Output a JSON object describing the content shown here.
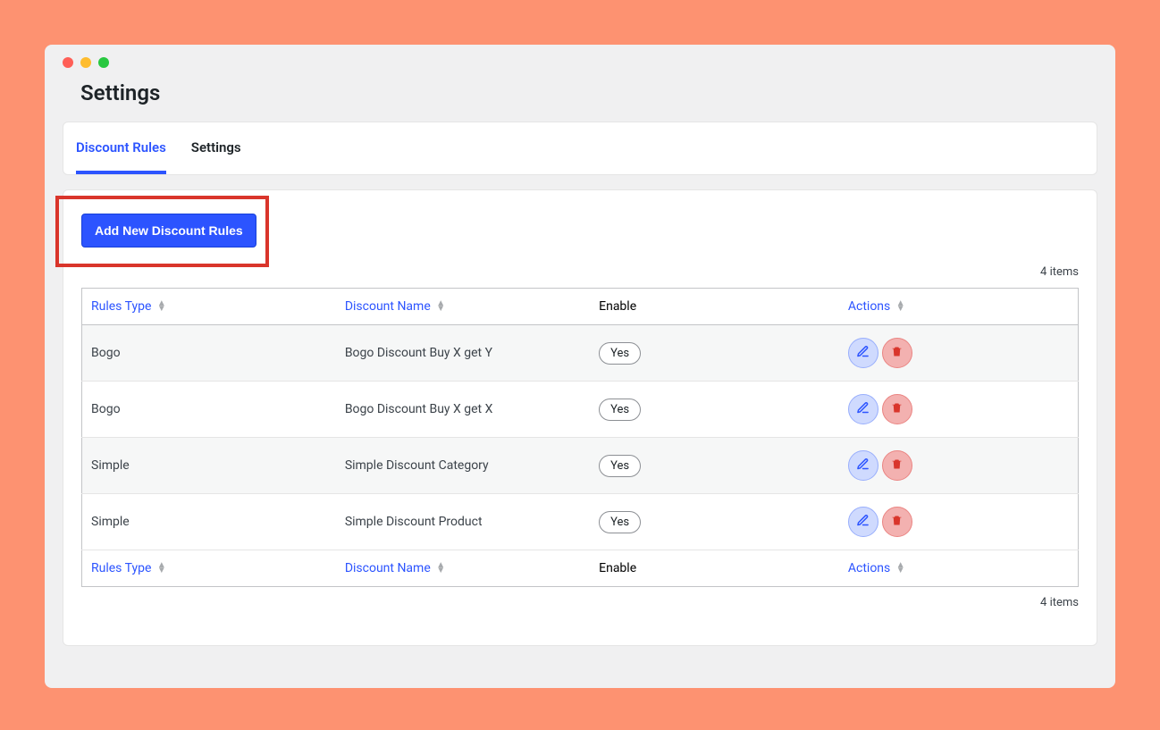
{
  "page_title": "Settings",
  "tabs": [
    {
      "label": "Discount Rules",
      "active": true
    },
    {
      "label": "Settings",
      "active": false
    }
  ],
  "buttons": {
    "add_new": "Add New Discount Rules"
  },
  "items_count_label": "4 items",
  "columns": {
    "rules_type": "Rules Type",
    "discount_name": "Discount Name",
    "enable": "Enable",
    "actions": "Actions"
  },
  "icons": {
    "edit": "pencil-icon",
    "delete": "trash-icon"
  },
  "rows": [
    {
      "type": "Bogo",
      "name": "Bogo Discount Buy X get Y",
      "enable": "Yes"
    },
    {
      "type": "Bogo",
      "name": "Bogo Discount Buy X get X",
      "enable": "Yes"
    },
    {
      "type": "Simple",
      "name": "Simple Discount Category",
      "enable": "Yes"
    },
    {
      "type": "Simple",
      "name": "Simple Discount Product",
      "enable": "Yes"
    }
  ]
}
